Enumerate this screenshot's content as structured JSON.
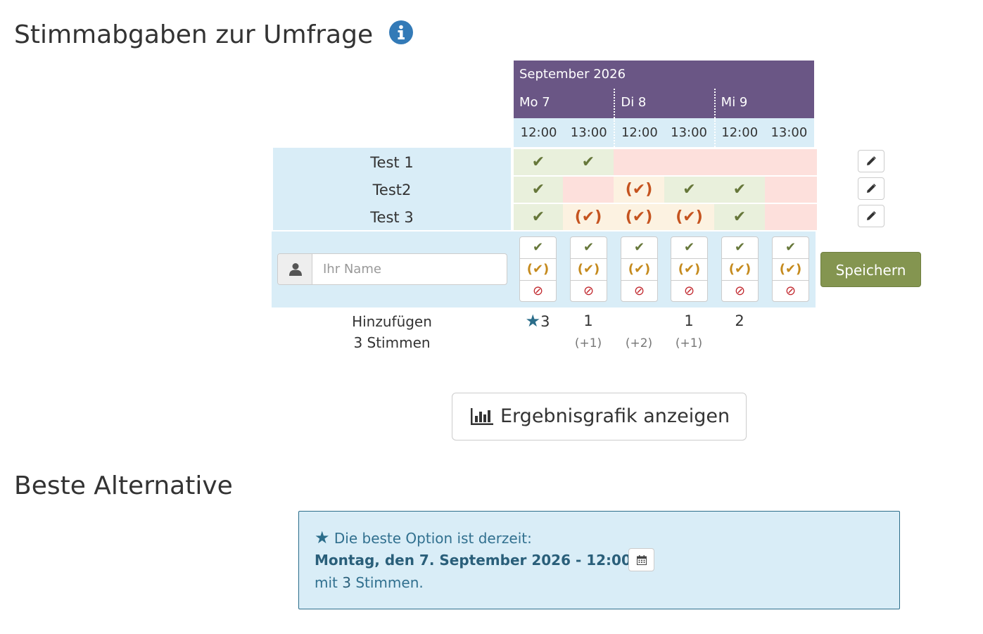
{
  "page": {
    "title": "Stimmabgaben zur Umfrage",
    "best_title": "Beste Alternative"
  },
  "poll": {
    "month": "September 2026",
    "days": [
      "Mo 7",
      "Di 8",
      "Mi 9"
    ],
    "hours": [
      "12:00",
      "13:00",
      "12:00",
      "13:00",
      "12:00",
      "13:00"
    ]
  },
  "votes": [
    {
      "name": "Test 1",
      "choices": [
        "yes",
        "yes",
        "no",
        "no",
        "no",
        "no"
      ]
    },
    {
      "name": "Test2",
      "choices": [
        "yes",
        "no",
        "maybe",
        "yes",
        "yes",
        "no"
      ]
    },
    {
      "name": "Test 3",
      "choices": [
        "yes",
        "maybe",
        "maybe",
        "maybe",
        "yes",
        "no"
      ]
    }
  ],
  "symbols": {
    "yes": "✔",
    "maybe": "(✔)",
    "no": "⊘",
    "star": "★"
  },
  "form": {
    "name_placeholder": "Ihr Name",
    "save_label": "Speichern"
  },
  "totals": {
    "add_label": "Hinzufügen",
    "vote_count": "3 Stimmen",
    "counts": [
      "3",
      "1",
      "",
      "1",
      "2",
      ""
    ],
    "extra": [
      "",
      "(+1)",
      "(+2)",
      "(+1)",
      "",
      ""
    ]
  },
  "graph_button": {
    "label": "Ergebnisgrafik anzeigen"
  },
  "best": {
    "intro": "Die beste Option ist derzeit:",
    "option": "Montag, den 7. September 2026 - 12:00",
    "suffix_pre": "mit ",
    "suffix_count": "3",
    "suffix_post": " Stimmen."
  },
  "colors": {
    "header": "#6a5685",
    "light_blue": "#d9edf7",
    "yes_bg": "#e9f0dc",
    "no_bg": "#fde0dc",
    "maybe_bg": "#fcf2e1",
    "save": "#849550"
  },
  "icons": {
    "info": "info-icon",
    "edit": "pencil-icon",
    "user": "user-icon",
    "chart": "bar-chart-icon",
    "calendar": "calendar-icon"
  }
}
